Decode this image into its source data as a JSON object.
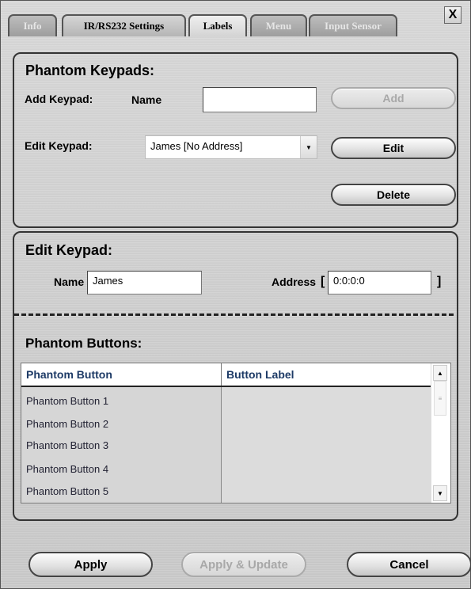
{
  "tabs": [
    {
      "label": "Info",
      "state": "inactive"
    },
    {
      "label": "IR/RS232 Settings",
      "state": "inactive"
    },
    {
      "label": "Labels",
      "state": "active"
    },
    {
      "label": "Menu",
      "state": "inactive"
    },
    {
      "label": "Input Sensor",
      "state": "inactive"
    }
  ],
  "close_label": "X",
  "phantom_keypads": {
    "title": "Phantom Keypads:",
    "add_label": "Add Keypad:",
    "name_label": "Name",
    "name_value": "",
    "add_button": "Add",
    "edit_label": "Edit Keypad:",
    "selected_keypad": "James [No Address]",
    "edit_button": "Edit",
    "delete_button": "Delete"
  },
  "edit_keypad": {
    "title": "Edit Keypad:",
    "name_label": "Name",
    "name_value": "James",
    "address_label": "Address",
    "address_open": "[",
    "address_value": "0:0:0:0",
    "address_close": "]"
  },
  "phantom_buttons": {
    "title": "Phantom Buttons:",
    "columns": [
      "Phantom Button",
      "Button Label"
    ],
    "rows": [
      {
        "button": "Phantom Button 1",
        "label": ""
      },
      {
        "button": "Phantom Button 2",
        "label": ""
      },
      {
        "button": "Phantom Button 3",
        "label": ""
      },
      {
        "button": "Phantom Button 4",
        "label": ""
      },
      {
        "button": "Phantom Button 5",
        "label": ""
      }
    ]
  },
  "footer": {
    "apply": "Apply",
    "apply_update": "Apply & Update",
    "cancel": "Cancel"
  },
  "icons": {
    "dropdown": "chevron-down-icon",
    "scroll_up": "arrow-up-icon",
    "scroll_down": "arrow-down-icon"
  }
}
